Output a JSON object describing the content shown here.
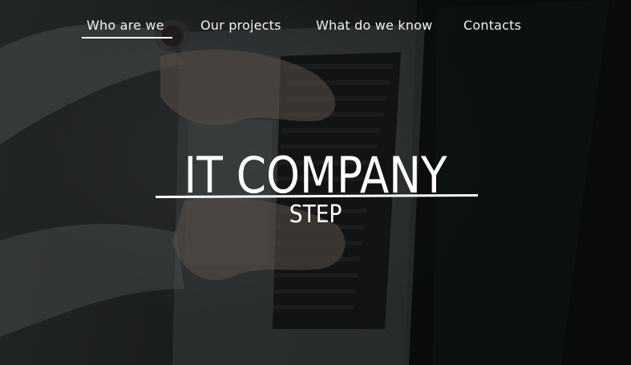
{
  "nav": {
    "items": [
      {
        "label": "Who are we",
        "active": true
      },
      {
        "label": "Our projects",
        "active": false
      },
      {
        "label": "What do we know",
        "active": false
      },
      {
        "label": "Contacts",
        "active": false
      }
    ]
  },
  "hero": {
    "title": "IT COMPANY",
    "subtitle": "STEP",
    "background_image": "laptop-typing-hands-photo"
  },
  "colors": {
    "text": "#ffffff",
    "overlay": "#1c1f1f"
  }
}
